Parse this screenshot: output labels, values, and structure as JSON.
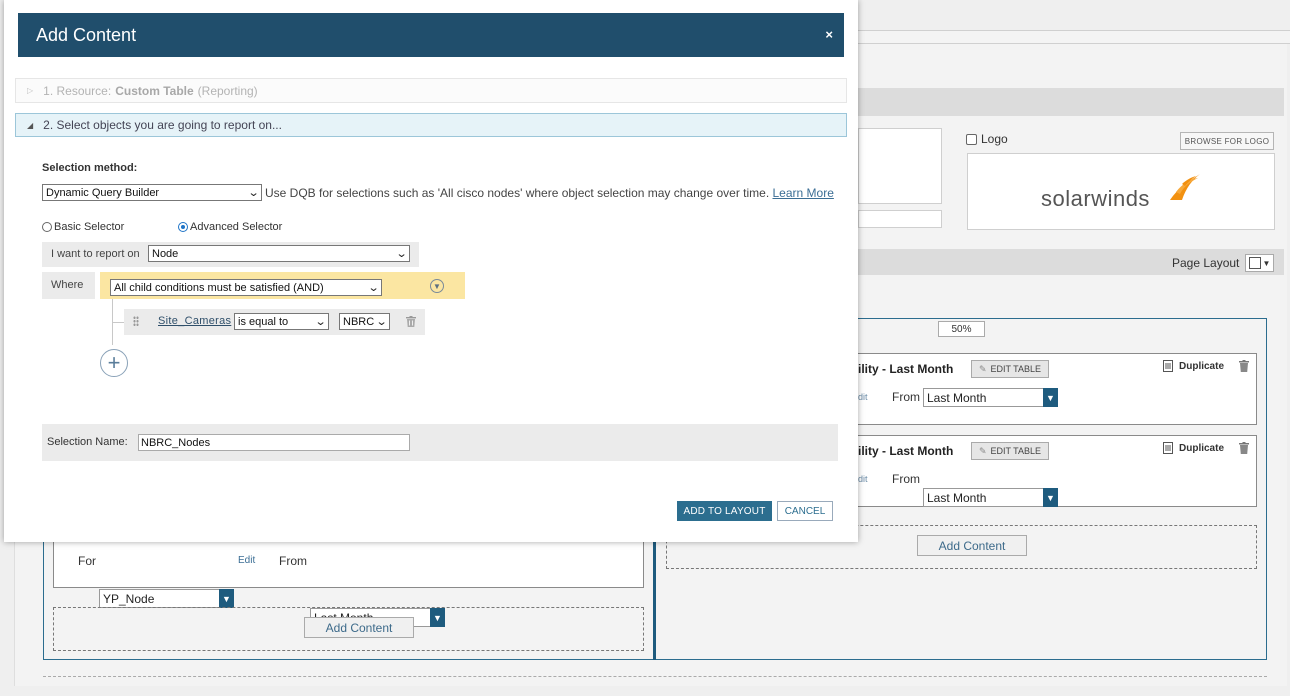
{
  "modal": {
    "title": "Add Content",
    "close_icon": "×",
    "step1": {
      "prefix": "1. Resource:",
      "resource": "Custom Table",
      "category": "(Reporting)"
    },
    "step2": {
      "label": "2. Select objects you are going to report on..."
    },
    "selection_method_label": "Selection method:",
    "selection_method_value": "Dynamic Query Builder",
    "dqb_help": "Use DQB for selections such as 'All cisco nodes' where object selection may change over time.",
    "learn_more": "Learn More",
    "radio_basic": "Basic Selector",
    "radio_advanced": "Advanced Selector",
    "selected_radio": "advanced",
    "report_on_label": "I want to report on",
    "report_on_value": "Node",
    "where_label": "Where",
    "condition_group_value": "All child conditions must be satisfied (AND)",
    "condition": {
      "field": "Site_Cameras",
      "operator": "is equal to",
      "value": "NBRC"
    },
    "selection_name_label": "Selection Name:",
    "selection_name_value": "NBRC_Nodes",
    "add_button": "ADD TO LAYOUT",
    "cancel_button": "CANCEL"
  },
  "background": {
    "logo_label": "Logo",
    "browse_for_logo": "BROWSE FOR LOGO",
    "brand_text": "solarwinds",
    "page_layout_label": "Page Layout",
    "column_width": "50%",
    "resources_right": [
      {
        "title": "ility - Last Month",
        "edit_table": "EDIT TABLE",
        "duplicate": "Duplicate",
        "edit_faint": "dit",
        "from_label": "From",
        "from_value": "Last Month"
      },
      {
        "title": "ility - Last Month",
        "edit_table": "EDIT TABLE",
        "duplicate": "Duplicate",
        "edit_faint": "dit",
        "from_label": "From",
        "from_value": "Last Month"
      }
    ],
    "left_resource": {
      "for_label": "For",
      "for_value": "YP_Node",
      "edit_link": "Edit",
      "from_label": "From",
      "from_value": "Last Month"
    },
    "add_content_right": "Add Content",
    "add_content_left": "Add Content"
  },
  "colors": {
    "header_bg": "#204e6c",
    "accent": "#2c6e8f",
    "condition_bg": "#fbe6a2",
    "logo_orange": "#f29111"
  }
}
